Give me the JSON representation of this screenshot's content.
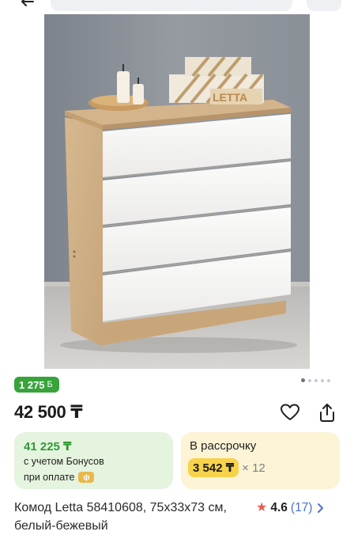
{
  "header": {
    "back_icon": "arrow-left-icon"
  },
  "gallery": {
    "image_description_icon": "product-photo",
    "dots_total": 5,
    "active_dot": 0
  },
  "bonus": {
    "amount": "1 275",
    "sign": "Б"
  },
  "price": {
    "value": "42 500 ₸"
  },
  "actions": {
    "favorite_icon": "heart-icon",
    "share_icon": "share-icon"
  },
  "bonus_offer": {
    "price": "41 225 ₸",
    "line1": "с учетом Бонусов",
    "line2": "при оплате",
    "pay_icon_label": "ф"
  },
  "installment": {
    "title": "В рассрочку",
    "monthly": "3 542 ₸",
    "multiplier": "× 12"
  },
  "product": {
    "title": "Комод Letta 58410608, 75x33x73 см, белый-бежевый",
    "rating": "4.6",
    "reviews": "(17)"
  },
  "colors": {
    "green": "#38a33b",
    "green_bg": "#e5f4de",
    "yellow_bg": "#fdf4d6",
    "yellow_chip": "#f7d24b",
    "star": "#e85b4e",
    "link": "#4a72c4"
  }
}
